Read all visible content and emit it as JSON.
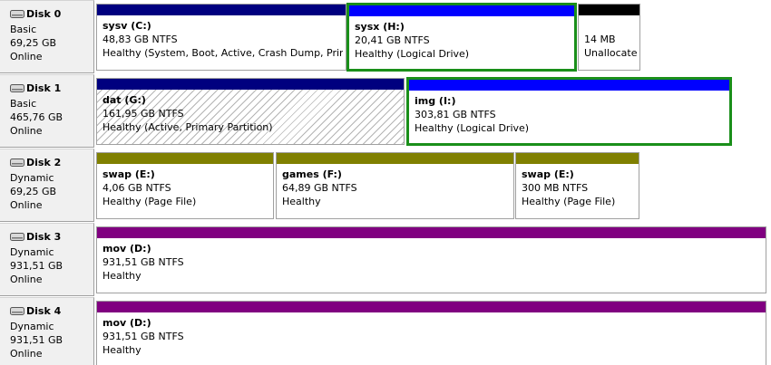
{
  "colors": {
    "primary": "#00007f",
    "logical": "#0000ff",
    "unallocated": "#000000",
    "simple": "#808000",
    "spanned": "#800080",
    "selection": "#1a8f1a"
  },
  "disks": [
    {
      "name": "Disk 0",
      "type": "Basic",
      "size": "69,25 GB",
      "status": "Online",
      "partitions": [
        {
          "name": "sysv  (C:)",
          "size": "48,83 GB NTFS",
          "status": "Healthy (System, Boot, Active, Crash Dump, Prim",
          "bar": "primary"
        },
        {
          "name": "sysx  (H:)",
          "size": "20,41 GB NTFS",
          "status": "Healthy (Logical Drive)",
          "bar": "logical",
          "selected": true
        },
        {
          "name": "",
          "size": "14 MB",
          "status": "Unallocated",
          "bar": "unallocated"
        }
      ]
    },
    {
      "name": "Disk 1",
      "type": "Basic",
      "size": "465,76 GB",
      "status": "Online",
      "partitions": [
        {
          "name": "dat  (G:)",
          "size": "161,95 GB NTFS",
          "status": "Healthy (Active, Primary Partition)",
          "bar": "primary",
          "hatched": true
        },
        {
          "name": "img  (I:)",
          "size": "303,81 GB NTFS",
          "status": "Healthy (Logical Drive)",
          "bar": "logical",
          "selected": true
        }
      ]
    },
    {
      "name": "Disk 2",
      "type": "Dynamic",
      "size": "69,25 GB",
      "status": "Online",
      "partitions": [
        {
          "name": "swap  (E:)",
          "size": "4,06 GB NTFS",
          "status": "Healthy (Page File)",
          "bar": "simple"
        },
        {
          "name": "games  (F:)",
          "size": "64,89 GB NTFS",
          "status": "Healthy",
          "bar": "simple"
        },
        {
          "name": "swap  (E:)",
          "size": "300 MB NTFS",
          "status": "Healthy (Page File)",
          "bar": "simple"
        }
      ]
    },
    {
      "name": "Disk 3",
      "type": "Dynamic",
      "size": "931,51 GB",
      "status": "Online",
      "partitions": [
        {
          "name": "mov  (D:)",
          "size": "931,51 GB NTFS",
          "status": "Healthy",
          "bar": "spanned"
        }
      ]
    },
    {
      "name": "Disk 4",
      "type": "Dynamic",
      "size": "931,51 GB",
      "status": "Online",
      "partitions": [
        {
          "name": "mov  (D:)",
          "size": "931,51 GB NTFS",
          "status": "Healthy",
          "bar": "spanned"
        }
      ]
    }
  ]
}
